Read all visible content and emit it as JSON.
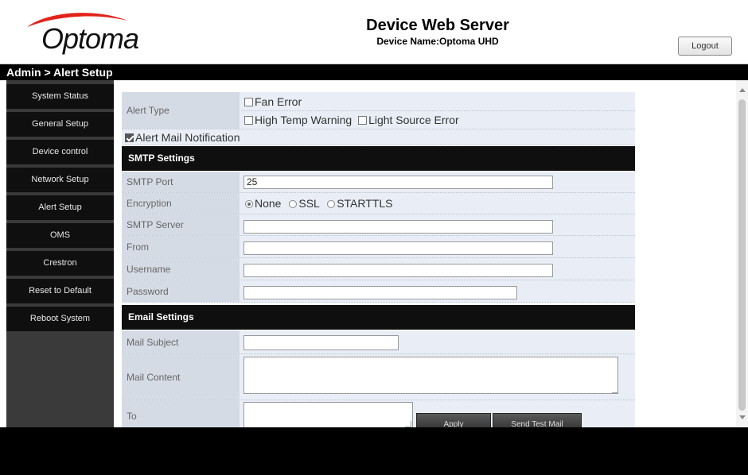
{
  "header": {
    "logo_text": "Optoma",
    "title": "Device Web Server",
    "device_name": "Device Name:Optoma UHD",
    "logout_label": "Logout",
    "logo_color": "#e2231a"
  },
  "breadcrumb": "Admin > Alert Setup",
  "sidebar": {
    "items": [
      {
        "label": "System Status"
      },
      {
        "label": "General Setup"
      },
      {
        "label": "Device control"
      },
      {
        "label": "Network Setup"
      },
      {
        "label": "Alert Setup"
      },
      {
        "label": "OMS"
      },
      {
        "label": "Crestron"
      },
      {
        "label": "Reset to Default"
      },
      {
        "label": "Reboot System"
      }
    ]
  },
  "alert_type": {
    "label": "Alert Type",
    "fan_error": {
      "label": "Fan Error",
      "checked": false
    },
    "high_temp": {
      "label": "High Temp Warning",
      "checked": false
    },
    "light_source": {
      "label": "Light Source Error",
      "checked": false
    }
  },
  "alert_mail": {
    "label": "Alert Mail Notification",
    "checked": true
  },
  "smtp": {
    "section_title": "SMTP Settings",
    "port_label": "SMTP Port",
    "port_value": "25",
    "encryption_label": "Encryption",
    "encryption_options": [
      "None",
      "SSL",
      "STARTTLS"
    ],
    "encryption_selected": "None",
    "server_label": "SMTP Server",
    "server_value": "",
    "from_label": "From",
    "from_value": "",
    "username_label": "Username",
    "username_value": "",
    "password_label": "Password",
    "password_value": ""
  },
  "email": {
    "section_title": "Email Settings",
    "subject_label": "Mail Subject",
    "subject_value": "",
    "content_label": "Mail Content",
    "content_value": "",
    "to_label": "To",
    "to_value": "",
    "apply_label": "Apply",
    "send_test_label": "Send Test Mail"
  }
}
